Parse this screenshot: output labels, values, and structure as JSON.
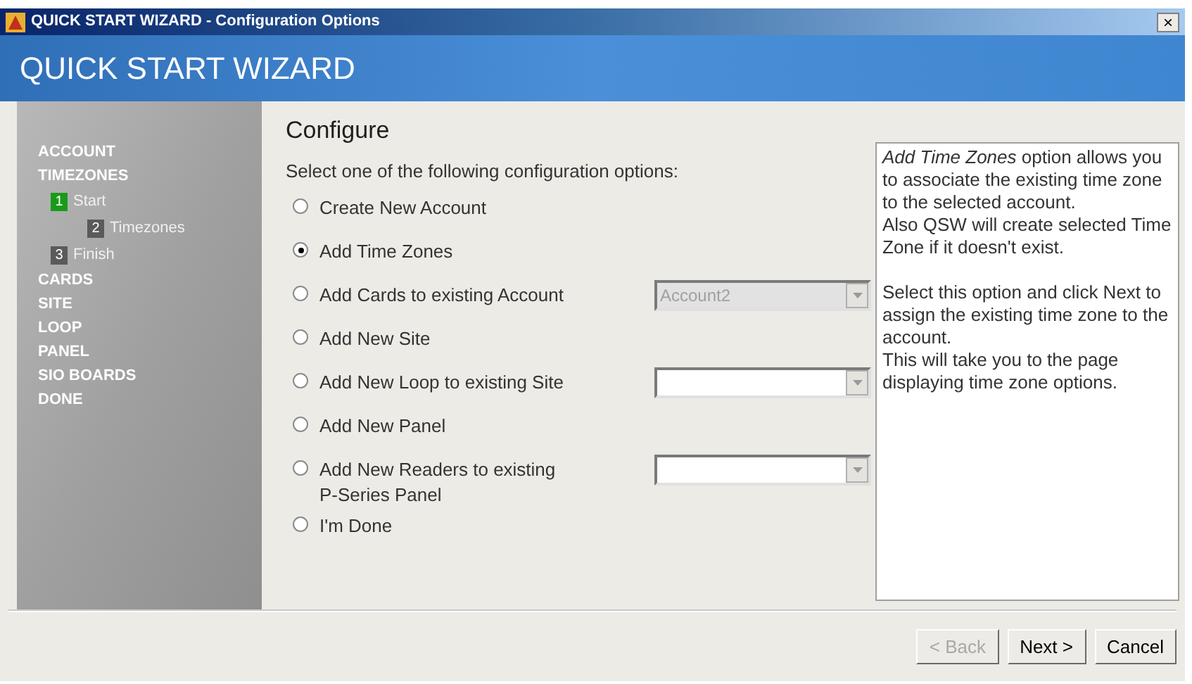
{
  "window": {
    "title": "QUICK START WIZARD - Configuration Options",
    "close": "×"
  },
  "banner": {
    "title": "QUICK START WIZARD"
  },
  "sidebar": {
    "items": [
      {
        "label": "ACCOUNT"
      },
      {
        "label": "TIMEZONES",
        "children": [
          {
            "number": "1",
            "label": "Start",
            "current": true,
            "children": [
              {
                "number": "2",
                "label": "Timezones",
                "current": false
              }
            ]
          },
          {
            "number": "3",
            "label": "Finish",
            "current": false
          }
        ]
      },
      {
        "label": "CARDS"
      },
      {
        "label": "SITE"
      },
      {
        "label": "LOOP"
      },
      {
        "label": "PANEL"
      },
      {
        "label": "SIO BOARDS"
      },
      {
        "label": "DONE"
      }
    ]
  },
  "main": {
    "heading": "Configure",
    "instruction": "Select one of the following configuration options:",
    "options": [
      {
        "label": "Create New Account",
        "selected": false
      },
      {
        "label": "Add Time Zones",
        "selected": true
      },
      {
        "label": "Add Cards to existing Account",
        "selected": false,
        "dropdown": {
          "value": "Account2",
          "disabled": true
        }
      },
      {
        "label": "Add New Site",
        "selected": false
      },
      {
        "label": "Add New Loop to existing Site",
        "selected": false,
        "dropdown": {
          "disabled": false
        }
      },
      {
        "label": "Add New Panel",
        "selected": false
      },
      {
        "label": "Add New Readers to existing\nP-Series Panel",
        "selected": false,
        "dropdown": {
          "disabled": false
        }
      },
      {
        "label": "I'm Done",
        "selected": false
      }
    ]
  },
  "help": {
    "paragraphs": [
      [
        "*Add Time Zones* option allows you to associate the existing time zone to the selected account.",
        "Also QSW will create selected Time Zone if it doesn't exist."
      ],
      [
        "Select this option and click Next to assign the existing time zone to the account.",
        "This will take you to the page displaying time zone options."
      ]
    ]
  },
  "buttons": [
    {
      "label": "< Back",
      "disabled": true
    },
    {
      "label": "Next >",
      "disabled": false
    },
    {
      "label": "Cancel",
      "disabled": false
    }
  ]
}
